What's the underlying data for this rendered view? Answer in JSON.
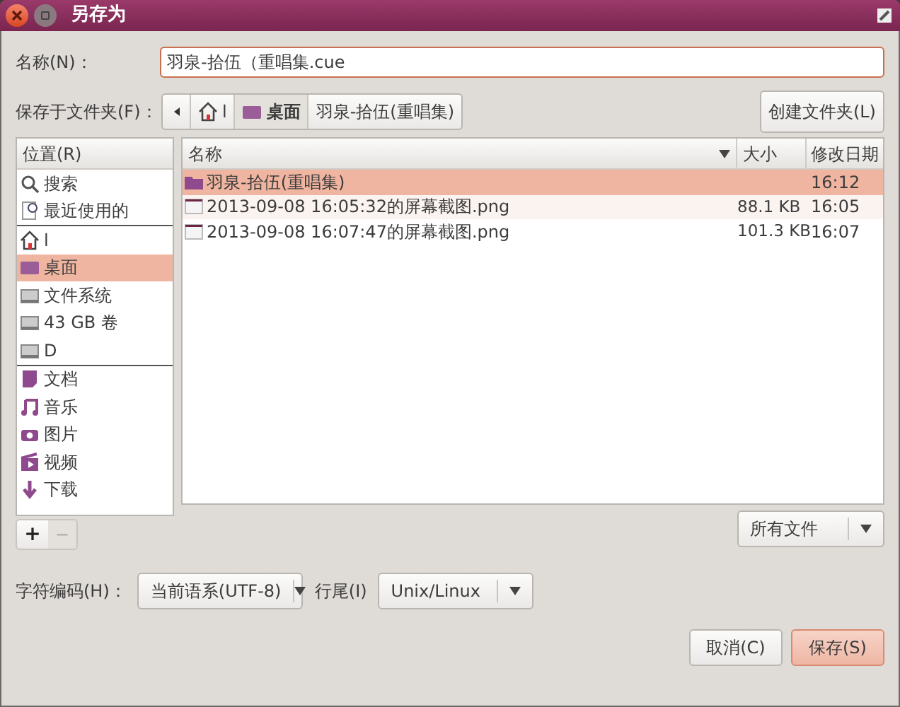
{
  "window": {
    "title": "另存为"
  },
  "name_field": {
    "label": "名称(N)：",
    "value": "羽泉-拾伍（重唱集.cue"
  },
  "folder": {
    "label": "保存于文件夹(F)：",
    "path": [
      {
        "label": "l",
        "kind": "home",
        "selected": false
      },
      {
        "label": "桌面",
        "kind": "desktop",
        "selected": true
      },
      {
        "label": "羽泉-拾伍(重唱集)",
        "kind": "plain",
        "selected": false
      }
    ],
    "create_button": "创建文件夹(L)"
  },
  "places": {
    "header": "位置(R)",
    "sections": [
      [
        {
          "label": "搜索",
          "kind": "search",
          "selected": false
        },
        {
          "label": "最近使用的",
          "kind": "recent",
          "selected": false
        }
      ],
      [
        {
          "label": "l",
          "kind": "home",
          "selected": false
        },
        {
          "label": "桌面",
          "kind": "desktop",
          "selected": true
        },
        {
          "label": "文件系统",
          "kind": "drive",
          "selected": false
        },
        {
          "label": "43 GB 卷",
          "kind": "drive",
          "selected": false
        },
        {
          "label": "D",
          "kind": "drive",
          "selected": false
        }
      ],
      [
        {
          "label": "文档",
          "kind": "document",
          "selected": false
        },
        {
          "label": "音乐",
          "kind": "music",
          "selected": false
        },
        {
          "label": "图片",
          "kind": "camera",
          "selected": false
        },
        {
          "label": "视频",
          "kind": "video",
          "selected": false
        },
        {
          "label": "下载",
          "kind": "download",
          "selected": false
        }
      ]
    ],
    "add": "+",
    "remove": "−"
  },
  "files": {
    "columns": [
      "名称",
      "大小",
      "修改日期"
    ],
    "rows": [
      {
        "name": "羽泉-拾伍(重唱集)",
        "size": "",
        "modified": "16:12",
        "kind": "folder",
        "selected": true
      },
      {
        "name": "2013-09-08 16:05:32的屏幕截图.png",
        "size": "88.1 KB",
        "modified": "16:05",
        "kind": "image",
        "selected": false
      },
      {
        "name": "2013-09-08 16:07:47的屏幕截图.png",
        "size": "101.3 KB",
        "modified": "16:07",
        "kind": "image",
        "selected": false
      }
    ]
  },
  "filter": {
    "value": "所有文件"
  },
  "encoding": {
    "label": "字符编码(H)：",
    "value": "当前语系(UTF-8)"
  },
  "line_ending": {
    "label": "行尾(I)",
    "value": "Unix/Linux"
  },
  "buttons": [
    {
      "label": "取消(C)",
      "kind": "cancel"
    },
    {
      "label": "保存(S)",
      "kind": "default"
    }
  ]
}
